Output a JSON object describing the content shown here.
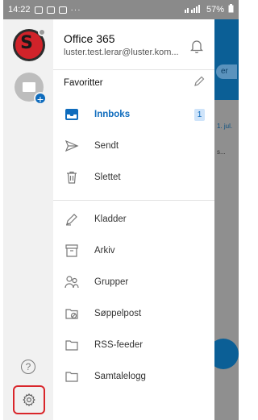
{
  "status_bar": {
    "time": "14:22",
    "dots": "···",
    "battery": "57%"
  },
  "account": {
    "name": "Office 365",
    "email": "luster.test.lerar@luster.kom..."
  },
  "favorites_header": "Favoritter",
  "favorites": [
    {
      "label": "Innboks",
      "icon": "inbox-icon",
      "badge": "1",
      "active": true
    },
    {
      "label": "Sendt",
      "icon": "send-icon"
    },
    {
      "label": "Slettet",
      "icon": "trash-icon"
    }
  ],
  "folders": [
    {
      "label": "Kladder",
      "icon": "draft-icon"
    },
    {
      "label": "Arkiv",
      "icon": "archive-icon"
    },
    {
      "label": "Grupper",
      "icon": "groups-icon"
    },
    {
      "label": "Søppelpost",
      "icon": "junk-folder-icon"
    },
    {
      "label": "RSS-feeder",
      "icon": "folder-icon"
    },
    {
      "label": "Samtalelogg",
      "icon": "folder-icon"
    }
  ],
  "rail": {
    "help_glyph": "?"
  },
  "background_app": {
    "pill": "er",
    "snippet1": "1. jul.",
    "snippet2": "s..."
  },
  "colors": {
    "accent": "#0f6cbd",
    "highlight_border": "#d9262b",
    "header_blue": "#0b5f96"
  }
}
